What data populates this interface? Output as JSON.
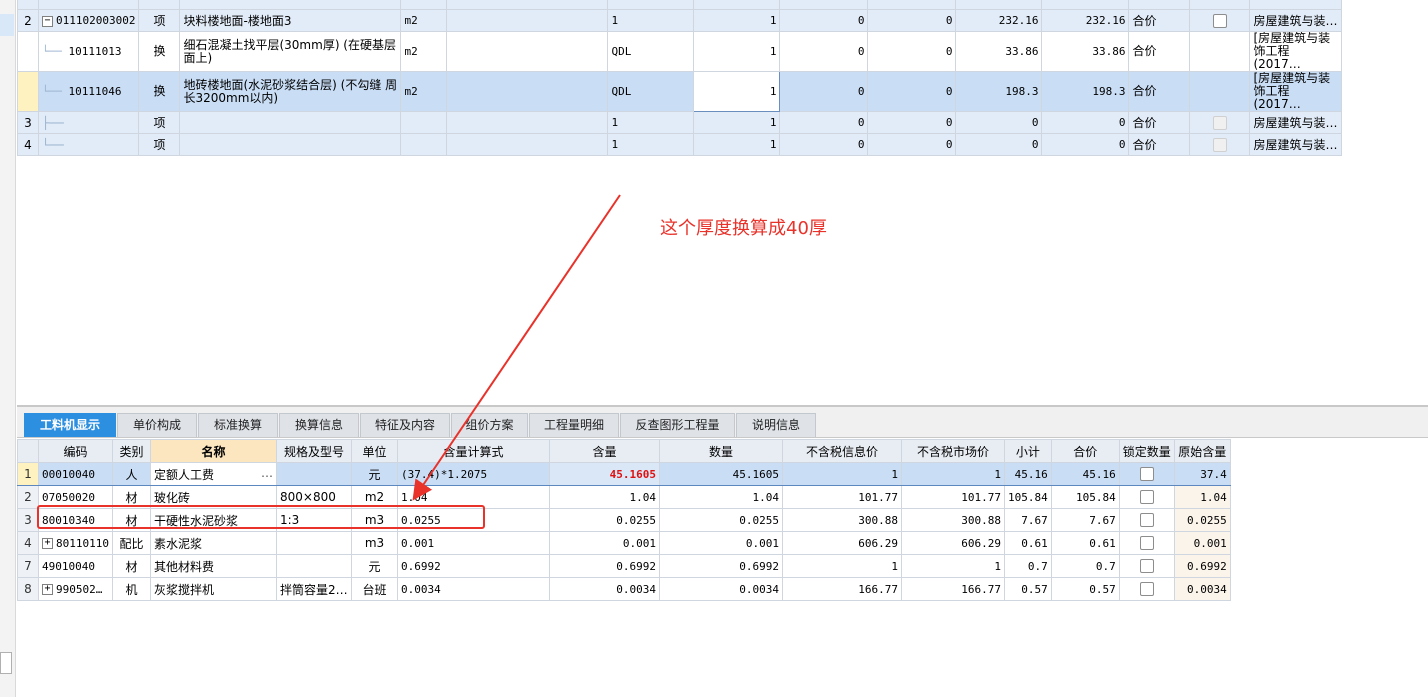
{
  "top_rows": [
    {
      "num": "2",
      "code": "011102003002",
      "type": "项",
      "name": "块料楼地面-楼地面3",
      "unit": "m2",
      "expr": "",
      "qty_expr": "1",
      "qty": "1",
      "c1": "0",
      "c2": "0",
      "price": "232.16",
      "total": "232.16",
      "calc": "合价",
      "prof": "房屋建筑与装…"
    },
    {
      "num": "",
      "code": "10111013",
      "type": "换",
      "name": "细石混凝土找平层(30mm厚) (在硬基层面上)",
      "unit": "m2",
      "expr": "",
      "qty_expr": "QDL",
      "qty": "1",
      "c1": "0",
      "c2": "0",
      "price": "33.86",
      "total": "33.86",
      "calc": "合价",
      "prof": "[房屋建筑与装饰工程 (2017…"
    },
    {
      "num": "",
      "code": "10111046",
      "type": "换",
      "name": "地砖楼地面(水泥砂浆结合层) (不勾缝 周长3200mm以内)",
      "unit": "m2",
      "expr": "",
      "qty_expr": "QDL",
      "qty": "1",
      "c1": "0",
      "c2": "0",
      "price": "198.3",
      "total": "198.3",
      "calc": "合价",
      "prof": "[房屋建筑与装饰工程 (2017…"
    },
    {
      "num": "3",
      "code": "",
      "type": "项",
      "name": "",
      "unit": "",
      "expr": "",
      "qty_expr": "1",
      "qty": "1",
      "c1": "0",
      "c2": "0",
      "price": "0",
      "total": "0",
      "calc": "合价",
      "prof": "房屋建筑与装…"
    },
    {
      "num": "4",
      "code": "",
      "type": "项",
      "name": "",
      "unit": "",
      "expr": "",
      "qty_expr": "1",
      "qty": "1",
      "c1": "0",
      "c2": "0",
      "price": "0",
      "total": "0",
      "calc": "合价",
      "prof": "房屋建筑与装…"
    }
  ],
  "annotation": "这个厚度换算成40厚",
  "tabs": [
    "工料机显示",
    "单价构成",
    "标准换算",
    "换算信息",
    "特征及内容",
    "组价方案",
    "工程量明细",
    "反查图形工程量",
    "说明信息"
  ],
  "bottom_headers": [
    "",
    "编码",
    "类别",
    "名称",
    "规格及型号",
    "单位",
    "含量计算式",
    "含量",
    "数量",
    "不含税信息价",
    "不含税市场价",
    "小计",
    "合价",
    "锁定数量",
    "原始含量"
  ],
  "bottom_rows": [
    {
      "rn": "1",
      "code": "00010040",
      "cat": "人",
      "name": "定额人工费",
      "spec": "",
      "unit": "元",
      "formula": "(37.4)*1.2075",
      "content": "45.1605",
      "qty": "45.1605",
      "info": "1",
      "market": "1",
      "sub": "45.16",
      "total": "45.16",
      "orig": "37.4"
    },
    {
      "rn": "2",
      "code": "07050020",
      "cat": "材",
      "name": "玻化砖",
      "spec": "800×800",
      "unit": "m2",
      "formula": "1.04",
      "content": "1.04",
      "qty": "1.04",
      "info": "101.77",
      "market": "101.77",
      "sub": "105.84",
      "total": "105.84",
      "orig": "1.04"
    },
    {
      "rn": "3",
      "code": "80010340",
      "cat": "材",
      "name": "干硬性水泥砂浆",
      "spec": "1:3",
      "unit": "m3",
      "formula": "0.0255",
      "content": "0.0255",
      "qty": "0.0255",
      "info": "300.88",
      "market": "300.88",
      "sub": "7.67",
      "total": "7.67",
      "orig": "0.0255"
    },
    {
      "rn": "4",
      "code": "80110110",
      "cat": "配比",
      "name": "素水泥浆",
      "spec": "",
      "unit": "m3",
      "formula": "0.001",
      "content": "0.001",
      "qty": "0.001",
      "info": "606.29",
      "market": "606.29",
      "sub": "0.61",
      "total": "0.61",
      "orig": "0.001"
    },
    {
      "rn": "7",
      "code": "49010040",
      "cat": "材",
      "name": "其他材料费",
      "spec": "",
      "unit": "元",
      "formula": "0.6992",
      "content": "0.6992",
      "qty": "0.6992",
      "info": "1",
      "market": "1",
      "sub": "0.7",
      "total": "0.7",
      "orig": "0.6992"
    },
    {
      "rn": "8",
      "code": "990502…",
      "cat": "机",
      "name": "灰浆搅拌机",
      "spec": "拌筒容量2…",
      "unit": "台班",
      "formula": "0.0034",
      "content": "0.0034",
      "qty": "0.0034",
      "info": "166.77",
      "market": "166.77",
      "sub": "0.57",
      "total": "0.57",
      "orig": "0.0034"
    }
  ],
  "colors": {
    "accent": "#2d8fe0",
    "annotation": "#e8322a",
    "selection": "#c9ddf5"
  },
  "icons": {
    "dots": "…",
    "expand": "+",
    "collapse": "−"
  }
}
